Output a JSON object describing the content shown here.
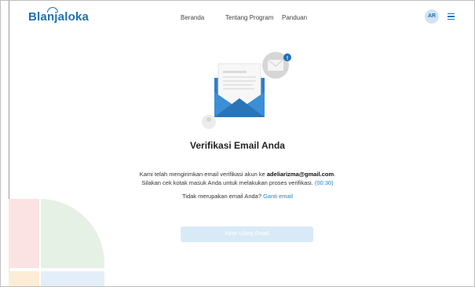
{
  "header": {
    "logo_text": "Blanjaloka",
    "nav": [
      "Beranda",
      "Tentang Program",
      "Panduan"
    ],
    "avatar_initials": "AR",
    "menu_icon": "hamburger-icon"
  },
  "main": {
    "title": "Verifikasi Email Anda",
    "message_prefix": "Kami telah mengirimkan email verifikasi akun ke ",
    "email": "adeliarizma@gmail.com",
    "message_suffix": ".",
    "message_line2": "Silakan cek kotak masuk Anda untuk melakukan proses verifikasi.",
    "countdown": "(00:30)",
    "wrong_email_text": "Tidak merupakan email Anda?",
    "change_email_link": "Ganti email",
    "resend_button": "Kirim Ulang Email",
    "notification_badge": "!"
  },
  "colors": {
    "brand": "#1d6fb8",
    "link": "#1d84d4",
    "envelope": "#2f7fc4",
    "button_disabled": "#d9eaf7"
  }
}
